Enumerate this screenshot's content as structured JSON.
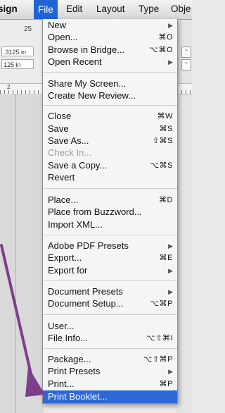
{
  "menubar": {
    "items": [
      "sign",
      "File",
      "Edit",
      "Layout",
      "Type",
      "Obje"
    ]
  },
  "background": {
    "value_top": "25",
    "field1": ".3125 in",
    "field2": "125 in",
    "ruler_number": "2"
  },
  "file_menu": {
    "items": [
      {
        "label": "New",
        "submenu": true
      },
      {
        "label": "Open...",
        "shortcut": "⌘O"
      },
      {
        "label": "Browse in Bridge...",
        "shortcut": "⌥⌘O"
      },
      {
        "label": "Open Recent",
        "submenu": true
      },
      {
        "label": "Share My Screen..."
      },
      {
        "label": "Create New Review..."
      },
      {
        "label": "Close",
        "shortcut": "⌘W"
      },
      {
        "label": "Save",
        "shortcut": "⌘S"
      },
      {
        "label": "Save As...",
        "shortcut": "⇧⌘S"
      },
      {
        "label": "Check In...",
        "disabled": true
      },
      {
        "label": "Save a Copy...",
        "shortcut": "⌥⌘S"
      },
      {
        "label": "Revert"
      },
      {
        "label": "Place...",
        "shortcut": "⌘D"
      },
      {
        "label": "Place from Buzzword..."
      },
      {
        "label": "Import XML..."
      },
      {
        "label": "Adobe PDF Presets",
        "submenu": true
      },
      {
        "label": "Export...",
        "shortcut": "⌘E"
      },
      {
        "label": "Export for",
        "submenu": true
      },
      {
        "label": "Document Presets",
        "submenu": true
      },
      {
        "label": "Document Setup...",
        "shortcut": "⌥⌘P"
      },
      {
        "label": "User..."
      },
      {
        "label": "File Info...",
        "shortcut": "⌥⇧⌘I"
      },
      {
        "label": "Package...",
        "shortcut": "⌥⇧⌘P"
      },
      {
        "label": "Print Presets",
        "submenu": true
      },
      {
        "label": "Print...",
        "shortcut": "⌘P"
      },
      {
        "label": "Print Booklet...",
        "highlighted": true
      }
    ]
  },
  "colors": {
    "menu_highlight": "#2d68d6",
    "arrow": "#7b3f8c"
  }
}
